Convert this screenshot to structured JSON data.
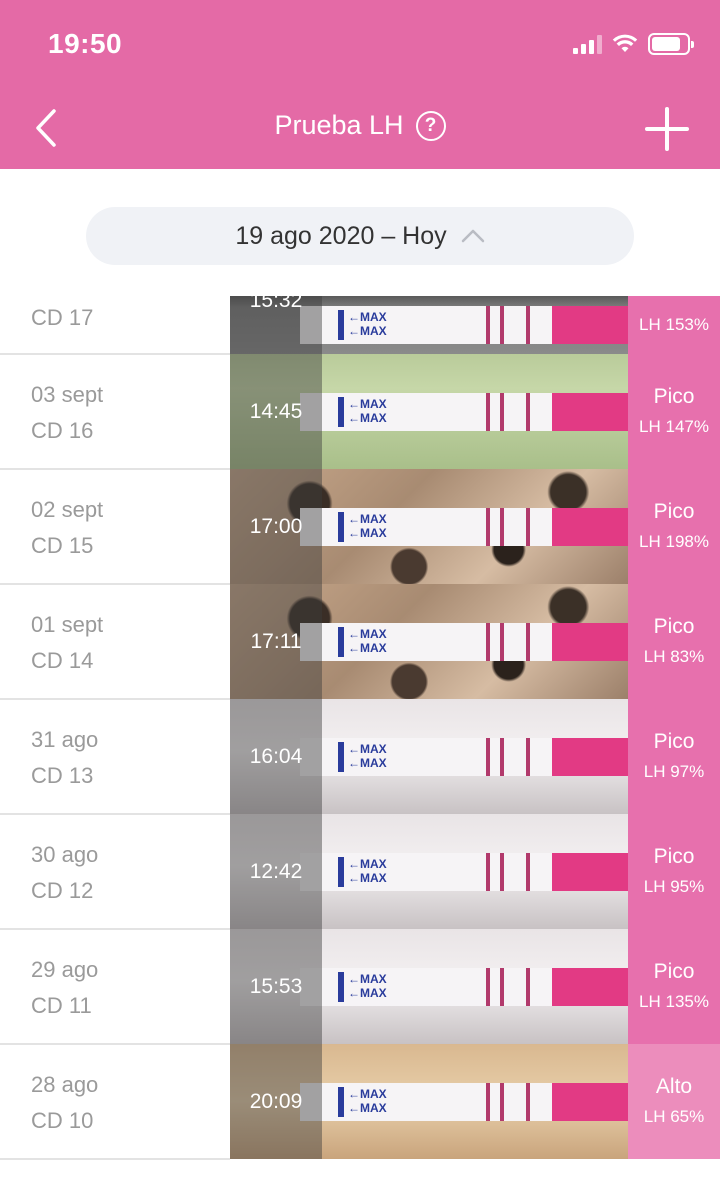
{
  "status_bar": {
    "time": "19:50"
  },
  "nav": {
    "title": "Prueba LH"
  },
  "filter": {
    "date_range": "19 ago 2020 – Hoy"
  },
  "colors": {
    "header": "#e46aa6",
    "result_pink": "#e770ad",
    "alto_pink": "#ec8dbc"
  },
  "tests": [
    {
      "date": "",
      "cycle_day": "CD 17",
      "time": "15:32",
      "level": "",
      "percent": "LH 153%",
      "scene": "gray"
    },
    {
      "date": "03 sept",
      "cycle_day": "CD 16",
      "time": "14:45",
      "level": "Pico",
      "percent": "LH 147%",
      "scene": "green"
    },
    {
      "date": "02 sept",
      "cycle_day": "CD 15",
      "time": "17:00",
      "level": "Pico",
      "percent": "LH 198%",
      "scene": "granite"
    },
    {
      "date": "01 sept",
      "cycle_day": "CD 14",
      "time": "17:11",
      "level": "Pico",
      "percent": "LH 83%",
      "scene": "granite"
    },
    {
      "date": "31 ago",
      "cycle_day": "CD 13",
      "time": "16:04",
      "level": "Pico",
      "percent": "LH 97%",
      "scene": "light"
    },
    {
      "date": "30 ago",
      "cycle_day": "CD 12",
      "time": "12:42",
      "level": "Pico",
      "percent": "LH 95%",
      "scene": "light"
    },
    {
      "date": "29 ago",
      "cycle_day": "CD 11",
      "time": "15:53",
      "level": "Pico",
      "percent": "LH 135%",
      "scene": "light"
    },
    {
      "date": "28 ago",
      "cycle_day": "CD 10",
      "time": "20:09",
      "level": "Alto",
      "percent": "LH 65%",
      "scene": "warm"
    }
  ]
}
